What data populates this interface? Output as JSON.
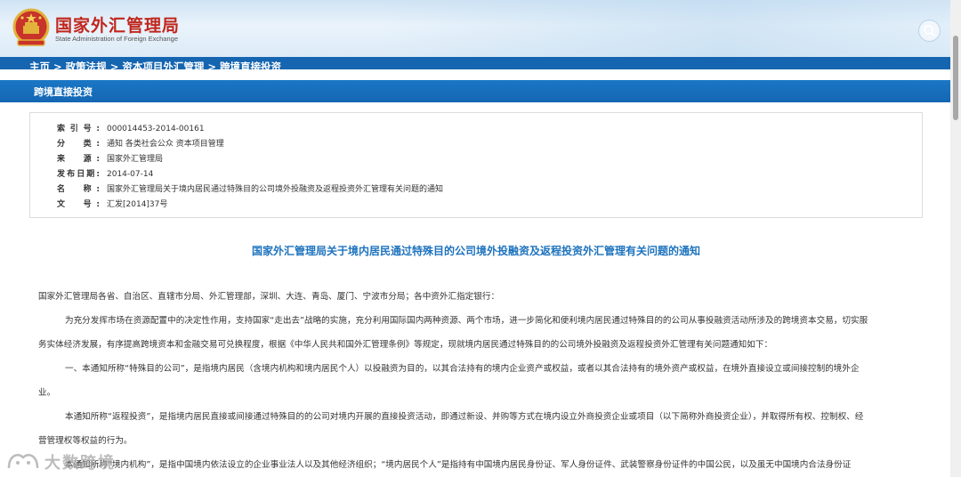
{
  "header": {
    "title": "国家外汇管理局",
    "subtitle": "State Administration of Foreign Exchange",
    "logo_icon": "national-emblem-icon",
    "search_icon": "search-icon"
  },
  "breadcrumb": {
    "items": [
      "主页",
      "政策法规",
      "资本项目外汇管理",
      "跨境直接投资"
    ],
    "separator": ">"
  },
  "section": {
    "title": "跨境直接投资"
  },
  "meta": {
    "rows": [
      {
        "label": "索引号:",
        "value": "000014453-2014-00161"
      },
      {
        "label": "分　类:",
        "value": "通知  各类社会公众  资本项目管理"
      },
      {
        "label": "来　源:",
        "value": "国家外汇管理局"
      },
      {
        "label": "发布日期:",
        "value": "2014-07-14"
      },
      {
        "label": "名　称:",
        "value": "国家外汇管理局关于境内居民通过特殊目的公司境外投融资及返程投资外汇管理有关问题的通知"
      },
      {
        "label": "文　号:",
        "value": "汇发[2014]37号"
      }
    ]
  },
  "document": {
    "title": "国家外汇管理局关于境内居民通过特殊目的公司境外投融资及返程投资外汇管理有关问题的通知",
    "lines": [
      "国家外汇管理局各省、自治区、直辖市分局、外汇管理部，深圳、大连、青岛、厦门、宁波市分局；各中资外汇指定银行：",
      "为充分发挥市场在资源配置中的决定性作用，支持国家“走出去”战略的实施，充分利用国际国内两种资源、两个市场，进一步简化和便利境内居民通过特殊目的的公司从事投融资活动所涉及的跨境资本交易，切实服",
      "务实体经济发展，有序提高跨境资本和金融交易可兑换程度，根据《中华人民共和国外汇管理条例》等规定，现就境内居民通过特殊目的的公司境外投融资及返程投资外汇管理有关问题通知如下：",
      "一、本通知所称“特殊目的公司”，是指境内居民（含境内机构和境内居民个人）以投融资为目的，以其合法持有的境内企业资产或权益，或者以其合法持有的境外资产或权益，在境外直接设立或间接控制的境外企",
      "业。",
      "本通知所称“返程投资”，是指境内居民直接或间接通过特殊目的的公司对境内开展的直接投资活动，即通过新设、并购等方式在境内设立外商投资企业或项目（以下简称外商投资企业），并取得所有权、控制权、经",
      "营管理权等权益的行为。",
      "本通知所称“境内机构”，是指中国境内依法设立的企业事业法人以及其他经济组织；“境内居民个人”是指持有中国境内居民身份证、军人身份证件、武装警察身份证件的中国公民，以及虽无中国境内合法身份证"
    ]
  },
  "watermark": {
    "text": "大数跨境"
  },
  "colors": {
    "brand_red": "#c0271e",
    "nav_blue": "#1565b0",
    "title_blue": "#1e73be"
  }
}
